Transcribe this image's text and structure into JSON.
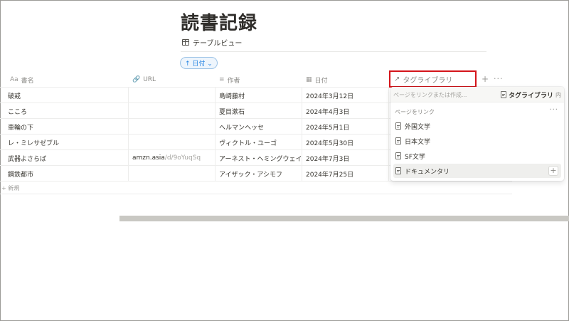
{
  "page": {
    "title": "読書記録"
  },
  "view": {
    "tab_label": "テーブルビュー"
  },
  "sort": {
    "label": "↑ 日付 ⌄"
  },
  "columns": {
    "title": {
      "icon": "Aa",
      "label": "書名"
    },
    "url": {
      "icon": "🔗",
      "label": "URL"
    },
    "author": {
      "icon": "≡",
      "label": "作者"
    },
    "date": {
      "icon": "▦",
      "label": "日付"
    }
  },
  "rows": [
    {
      "title": "破戒",
      "url_host": "",
      "url_path": "",
      "author": "島崎藤村",
      "date": "2024年3月12日"
    },
    {
      "title": "こころ",
      "url_host": "",
      "url_path": "",
      "author": "夏目漱石",
      "date": "2024年4月3日"
    },
    {
      "title": "車輪の下",
      "url_host": "",
      "url_path": "",
      "author": "ヘルマンヘッセ",
      "date": "2024年5月1日"
    },
    {
      "title": "レ・ミレサゼブル",
      "url_host": "",
      "url_path": "",
      "author": "ヴィクトル・ユーゴ",
      "date": "2024年5月30日"
    },
    {
      "title": "武器よさらば",
      "url_host": "amzn.asia",
      "url_path": "/d/9oYuqSq",
      "author": "アーネスト・ヘミングウェイ",
      "date": "2024年7月3日"
    },
    {
      "title": "鋼鉄都市",
      "url_host": "",
      "url_path": "",
      "author": "アイザック・アシモフ",
      "date": "2024年7月25日"
    }
  ],
  "new_row": {
    "label": "+ 新規"
  },
  "relation_header": {
    "icon": "↗",
    "value": "タグライブラリ"
  },
  "header_actions": {
    "add": "+",
    "more": "···"
  },
  "relation_dropdown": {
    "search_placeholder": "ページをリンクまたは作成...",
    "target_db": "タグライブラリ",
    "target_suffix": "内",
    "section_label": "ページをリンク",
    "section_more": "···",
    "items": [
      "外国文学",
      "日本文学",
      "SF文学",
      "ドキュメンタリ"
    ],
    "item_add": "+"
  }
}
